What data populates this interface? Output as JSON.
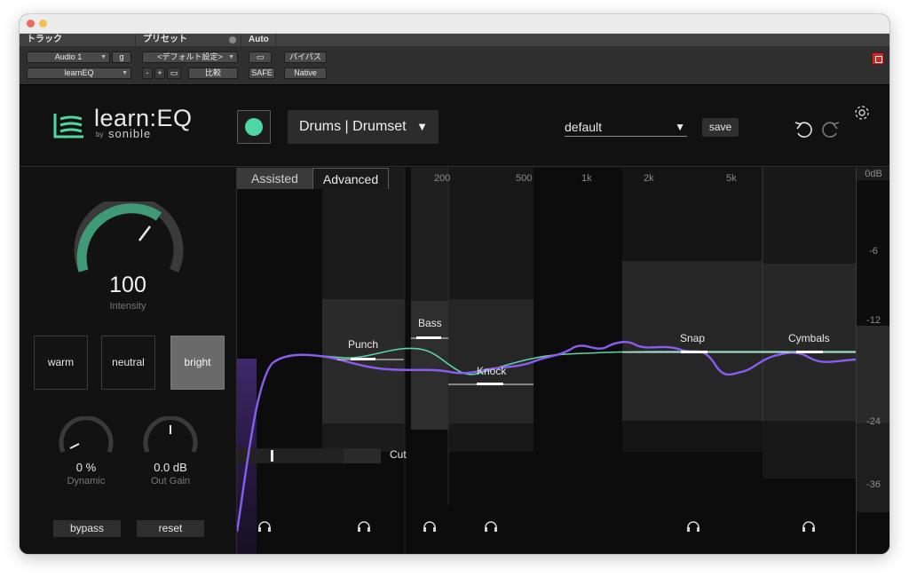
{
  "host": {
    "track_header": "トラック",
    "preset_header": "プリセット",
    "auto_header": "Auto",
    "track_name": "Audio 1",
    "track_group": "g",
    "plugin_name": "learnEQ",
    "preset_value": "<デフォルト設定>",
    "minus": "-",
    "plus": "+",
    "compare": "比較",
    "safe": "SAFE",
    "bypass": "バイパス",
    "native": "Native"
  },
  "plugin": {
    "logo_text": "learn:EQ",
    "logo_by": "by",
    "logo_brand": "sonible",
    "profile": "Drums | Drumset",
    "preset": "default",
    "save_label": "save",
    "accent": "#4ed6a4",
    "curve_color": "#8a5cf0"
  },
  "left": {
    "intensity_value": "100",
    "intensity_label": "Intensity",
    "modes": [
      "warm",
      "neutral",
      "bright"
    ],
    "active_mode": "bright",
    "dynamic_value": "0 %",
    "dynamic_label": "Dynamic",
    "gain_value": "0.0 dB",
    "gain_label": "Out Gain",
    "bypass_label": "bypass",
    "reset_label": "reset"
  },
  "eq": {
    "tabs": [
      "Assisted",
      "Advanced"
    ],
    "active_tab": "Advanced",
    "freq_labels": [
      "200",
      "500",
      "1k",
      "2k",
      "5k"
    ],
    "bands": [
      "Punch",
      "Bass",
      "Knock",
      "Snap",
      "Cymbals"
    ],
    "cut_label": "Cut"
  },
  "meter": {
    "ticks": [
      "0dB",
      "-6",
      "-12",
      "-24",
      "-36"
    ]
  }
}
